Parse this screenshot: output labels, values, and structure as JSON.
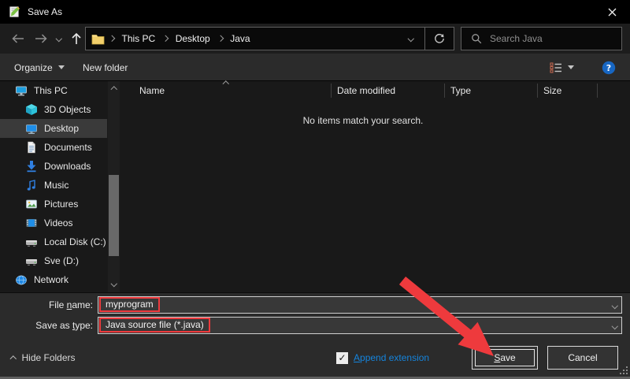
{
  "window": {
    "title": "Save As"
  },
  "nav": {
    "breadcrumb": {
      "segments": [
        "This PC",
        "Desktop",
        "Java"
      ]
    },
    "search_placeholder": "Search Java"
  },
  "toolbar": {
    "organize_label": "Organize",
    "new_folder_label": "New folder"
  },
  "sidebar": {
    "items": [
      {
        "label": "This PC",
        "icon": "computer-icon",
        "level": 0,
        "selected": false
      },
      {
        "label": "3D Objects",
        "icon": "cube-icon",
        "level": 1,
        "selected": false
      },
      {
        "label": "Desktop",
        "icon": "desktop-icon",
        "level": 1,
        "selected": true
      },
      {
        "label": "Documents",
        "icon": "document-icon",
        "level": 1,
        "selected": false
      },
      {
        "label": "Downloads",
        "icon": "download-icon",
        "level": 1,
        "selected": false
      },
      {
        "label": "Music",
        "icon": "music-note-icon",
        "level": 1,
        "selected": false
      },
      {
        "label": "Pictures",
        "icon": "picture-icon",
        "level": 1,
        "selected": false
      },
      {
        "label": "Videos",
        "icon": "video-icon",
        "level": 1,
        "selected": false
      },
      {
        "label": "Local Disk (C:)",
        "icon": "hard-drive-icon",
        "level": 1,
        "selected": false
      },
      {
        "label": "Sve (D:)",
        "icon": "hard-drive-icon",
        "level": 1,
        "selected": false
      },
      {
        "label": "Network",
        "icon": "network-icon",
        "level": 0,
        "selected": false
      }
    ]
  },
  "file_list": {
    "columns": [
      {
        "label": "Name",
        "sorted": true
      },
      {
        "label": "Date modified",
        "sorted": false
      },
      {
        "label": "Type",
        "sorted": false
      },
      {
        "label": "Size",
        "sorted": false
      }
    ],
    "empty_message": "No items match your search."
  },
  "fields": {
    "file_name": {
      "label_pre": "File ",
      "label_key": "n",
      "label_post": "ame:",
      "value": "myprogram"
    },
    "save_as_type": {
      "label_pre": "Save as ",
      "label_key": "t",
      "label_post": "ype:",
      "value": "Java source file (*.java)"
    }
  },
  "footer": {
    "hide_folders_label": "Hide Folders",
    "append_extension": {
      "label_key": "A",
      "label_post": "ppend extension",
      "checked": true,
      "checkmark": "✓"
    },
    "save_button": {
      "label_key": "S",
      "label_post": "ave"
    },
    "cancel_label": "Cancel"
  },
  "colors": {
    "annotation_red": "#ee3a3d",
    "link_blue": "#1584dc",
    "accent_help": "#1766c2"
  }
}
